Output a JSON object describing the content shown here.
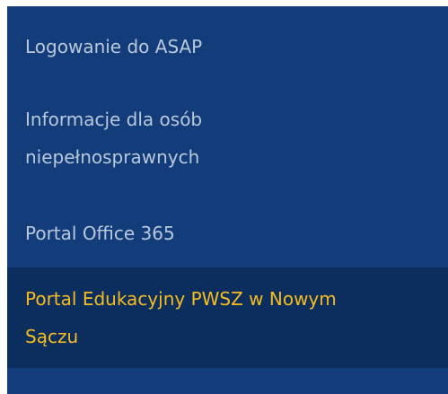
{
  "menu": {
    "items": [
      {
        "label": "Logowanie do ASAP"
      },
      {
        "label": "Informacje dla osób niepełnosprawnych"
      },
      {
        "label": "Portal Office 365"
      },
      {
        "label": "Portal Edukacyjny PWSZ w Nowym Sączu",
        "active": true
      }
    ]
  },
  "colors": {
    "menu_background": "#133d7a",
    "active_background": "#0b2e5e",
    "text": "#b9c8db",
    "active_text": "#f5bd1f"
  }
}
